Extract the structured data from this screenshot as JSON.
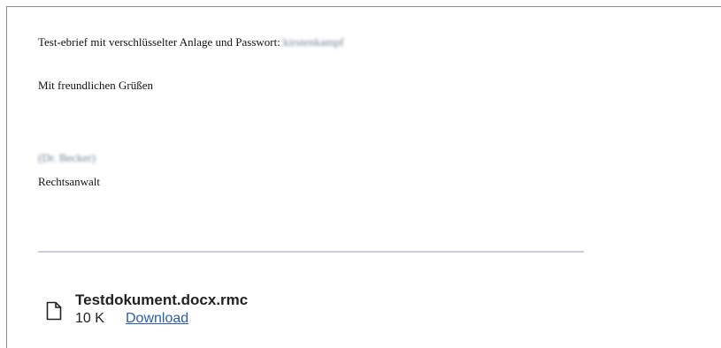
{
  "email": {
    "line1_text": "Test-ebrief mit verschlüsselter Anlage und Passwort:",
    "password_redacted": "kirstenkampf",
    "closing": "Mit freundlichen Grüßen",
    "signature_name_redacted": "(Dr. Becker)",
    "signature_title": "Rechtsanwalt"
  },
  "attachment": {
    "filename": "Testdokument.docx.rmc",
    "size": "10 K",
    "download_label": "Download",
    "icon": "file-icon"
  },
  "colors": {
    "link": "#2a5db0",
    "divider": "#c9cedd",
    "frame_border": "#8a8a8a"
  }
}
